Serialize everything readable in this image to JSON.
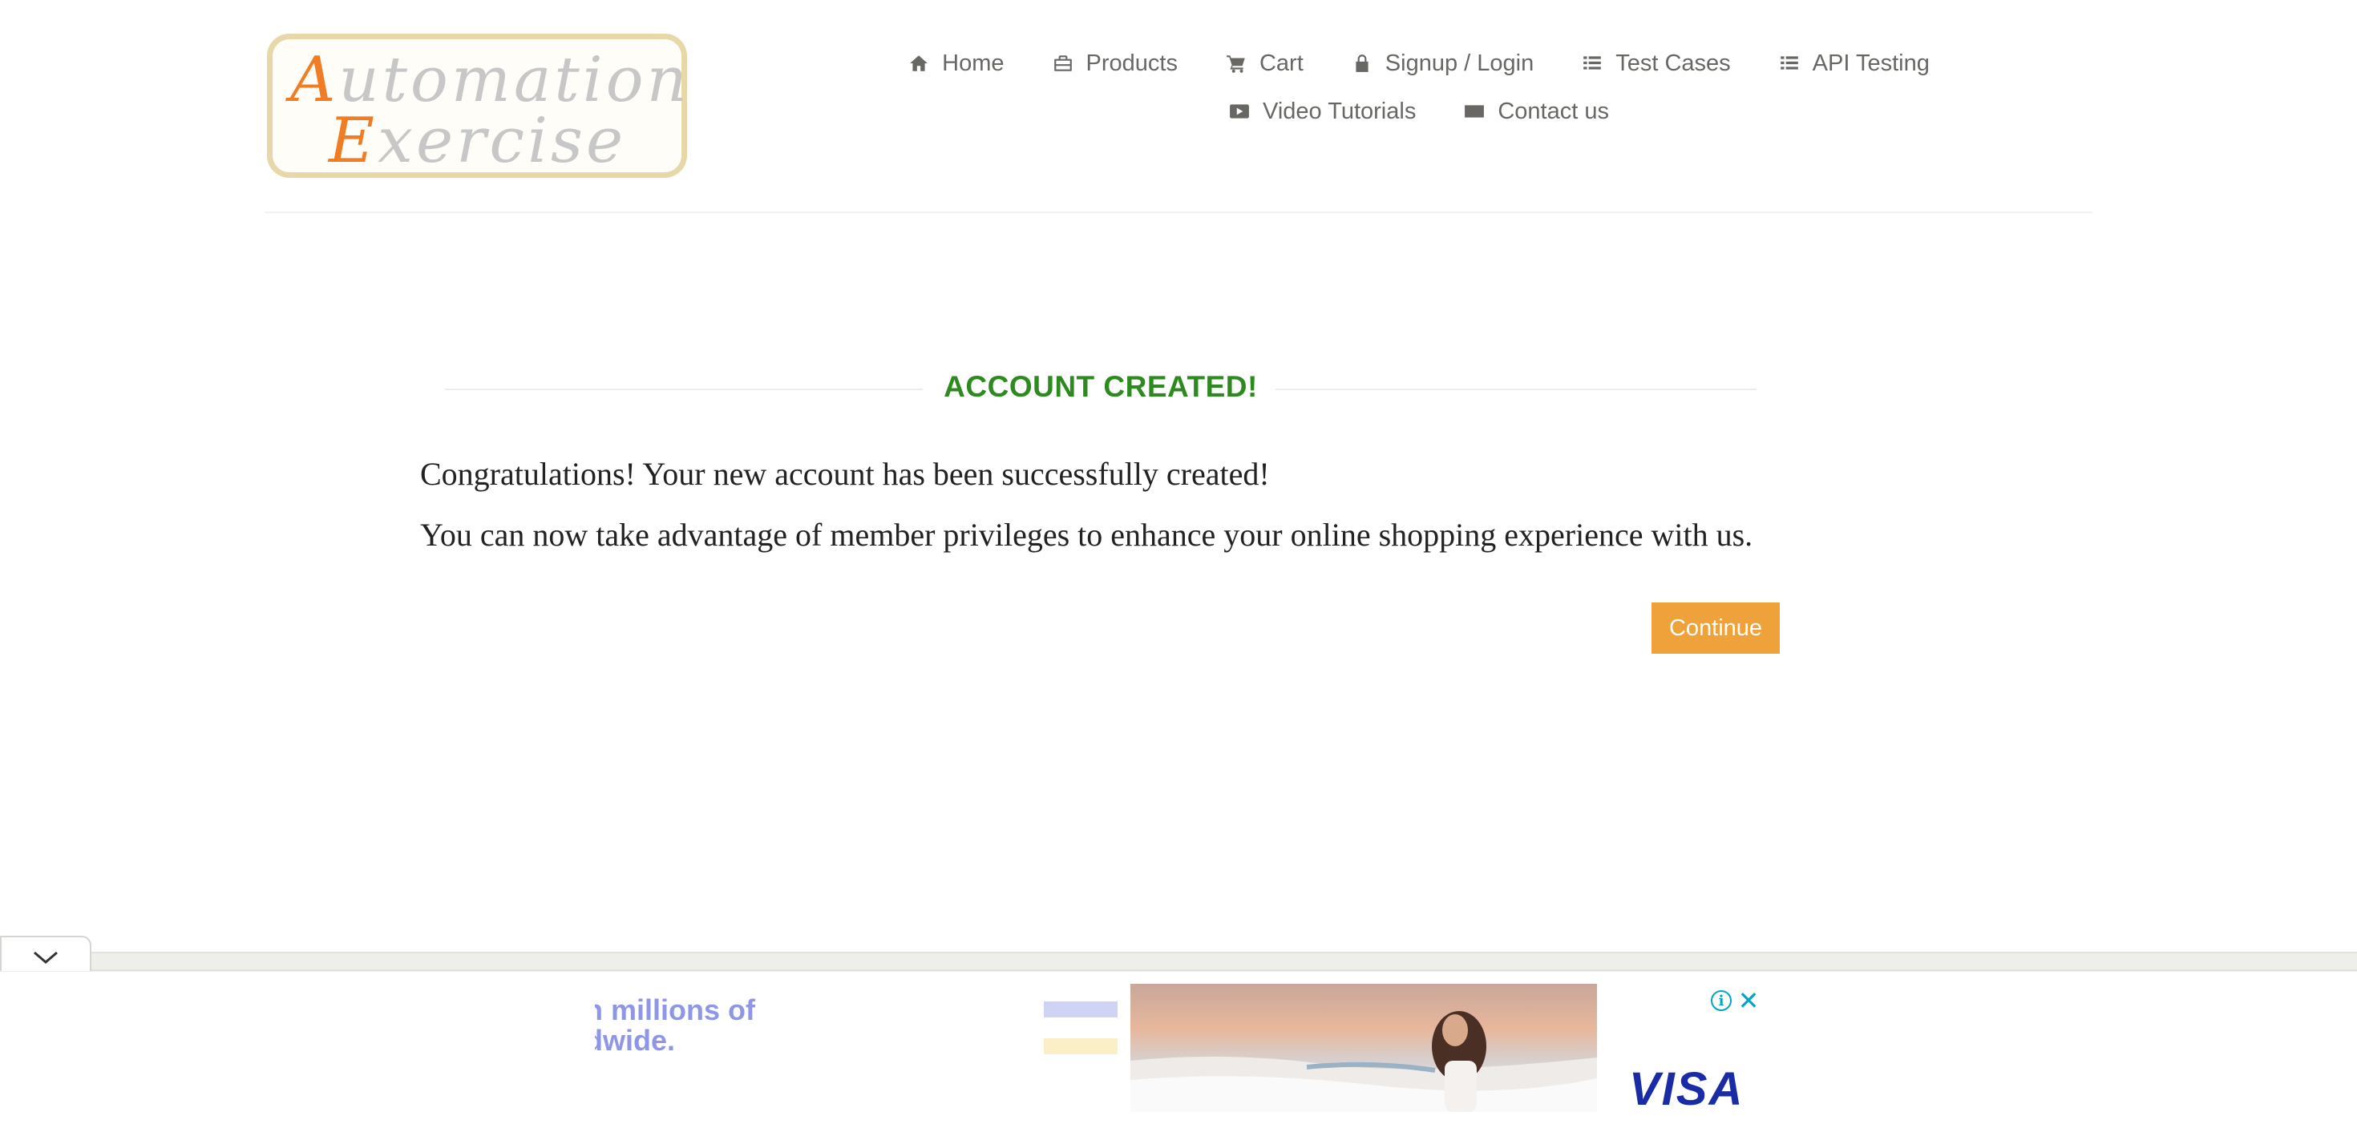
{
  "logo": {
    "line1_cap": "A",
    "line1_rest": "utomation",
    "line2_cap": "E",
    "line2_rest": "xercise"
  },
  "nav": {
    "items": [
      {
        "label": "Home",
        "icon": "home-icon"
      },
      {
        "label": "Products",
        "icon": "briefcase-icon"
      },
      {
        "label": "Cart",
        "icon": "cart-icon"
      },
      {
        "label": "Signup / Login",
        "icon": "lock-icon"
      },
      {
        "label": "Test Cases",
        "icon": "list-icon"
      },
      {
        "label": "API Testing",
        "icon": "list-icon"
      },
      {
        "label": "Video Tutorials",
        "icon": "youtube-play-icon"
      },
      {
        "label": "Contact us",
        "icon": "envelope-icon"
      }
    ]
  },
  "main": {
    "title": "ACCOUNT CREATED!",
    "message1": "Congratulations! Your new account has been successfully created!",
    "message2": "You can now take advantage of member privileges to enhance your online shopping experience with us.",
    "continue_label": "Continue"
  },
  "ad": {
    "text_line1": "n millions of",
    "text_line2": "dwide.",
    "brand": "VISA",
    "info_glyph": "i",
    "close_glyph": "✕"
  },
  "colors": {
    "title_green": "#2d8a1f",
    "button_orange": "#f0a23a",
    "nav_text": "#696763",
    "logo_orange": "#f07c24",
    "ad_accent": "#00a5c8",
    "visa_blue": "#1a2ba6"
  }
}
